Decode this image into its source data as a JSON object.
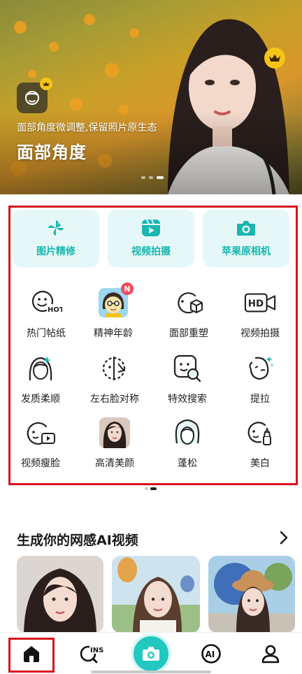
{
  "banner": {
    "subtitle": "面部角度微调整,保留照片原生态",
    "title": "面部角度",
    "feature_icon": "face-angle-icon",
    "badge_icon": "crown-icon"
  },
  "tools": [
    {
      "label": "图片精修",
      "icon": "pinwheel-icon"
    },
    {
      "label": "视频拍摄",
      "icon": "video-play-icon"
    },
    {
      "label": "苹果原相机",
      "icon": "camera-icon"
    }
  ],
  "features": [
    {
      "label": "热门帖纸",
      "icon": "hot-sticker-icon"
    },
    {
      "label": "精神年龄",
      "icon": "cartoon-avatar-icon",
      "badge": "N"
    },
    {
      "label": "面部重塑",
      "icon": "face-cube-icon"
    },
    {
      "label": "视频拍摄",
      "icon": "hd-camera-icon",
      "icon_text": "HD"
    },
    {
      "label": "发质柔顺",
      "icon": "hair-smooth-icon"
    },
    {
      "label": "左右脸对称",
      "icon": "face-symmetry-icon"
    },
    {
      "label": "特效搜索",
      "icon": "effect-search-icon"
    },
    {
      "label": "提拉",
      "icon": "face-lift-icon"
    },
    {
      "label": "视频瘦脸",
      "icon": "video-slim-face-icon"
    },
    {
      "label": "高清美颜",
      "icon": "portrait-photo-icon"
    },
    {
      "label": "蓬松",
      "icon": "fluffy-hair-icon"
    },
    {
      "label": "美白",
      "icon": "whitening-icon"
    }
  ],
  "section": {
    "title": "生成你的网感AI视频",
    "arrow_icon": "chevron-right-icon"
  },
  "nav": {
    "home_icon": "home-icon",
    "ins_label": "INS",
    "ai_label": "AI",
    "camera_icon": "camera-icon",
    "profile_icon": "person-icon"
  },
  "colors": {
    "accent": "#22c7c0",
    "accent_text": "#1ab6b0",
    "card_bg": "#e5f8f7",
    "highlight_border": "#d8141f",
    "crown": "#f5c417",
    "new_badge": "#f04a5f"
  }
}
